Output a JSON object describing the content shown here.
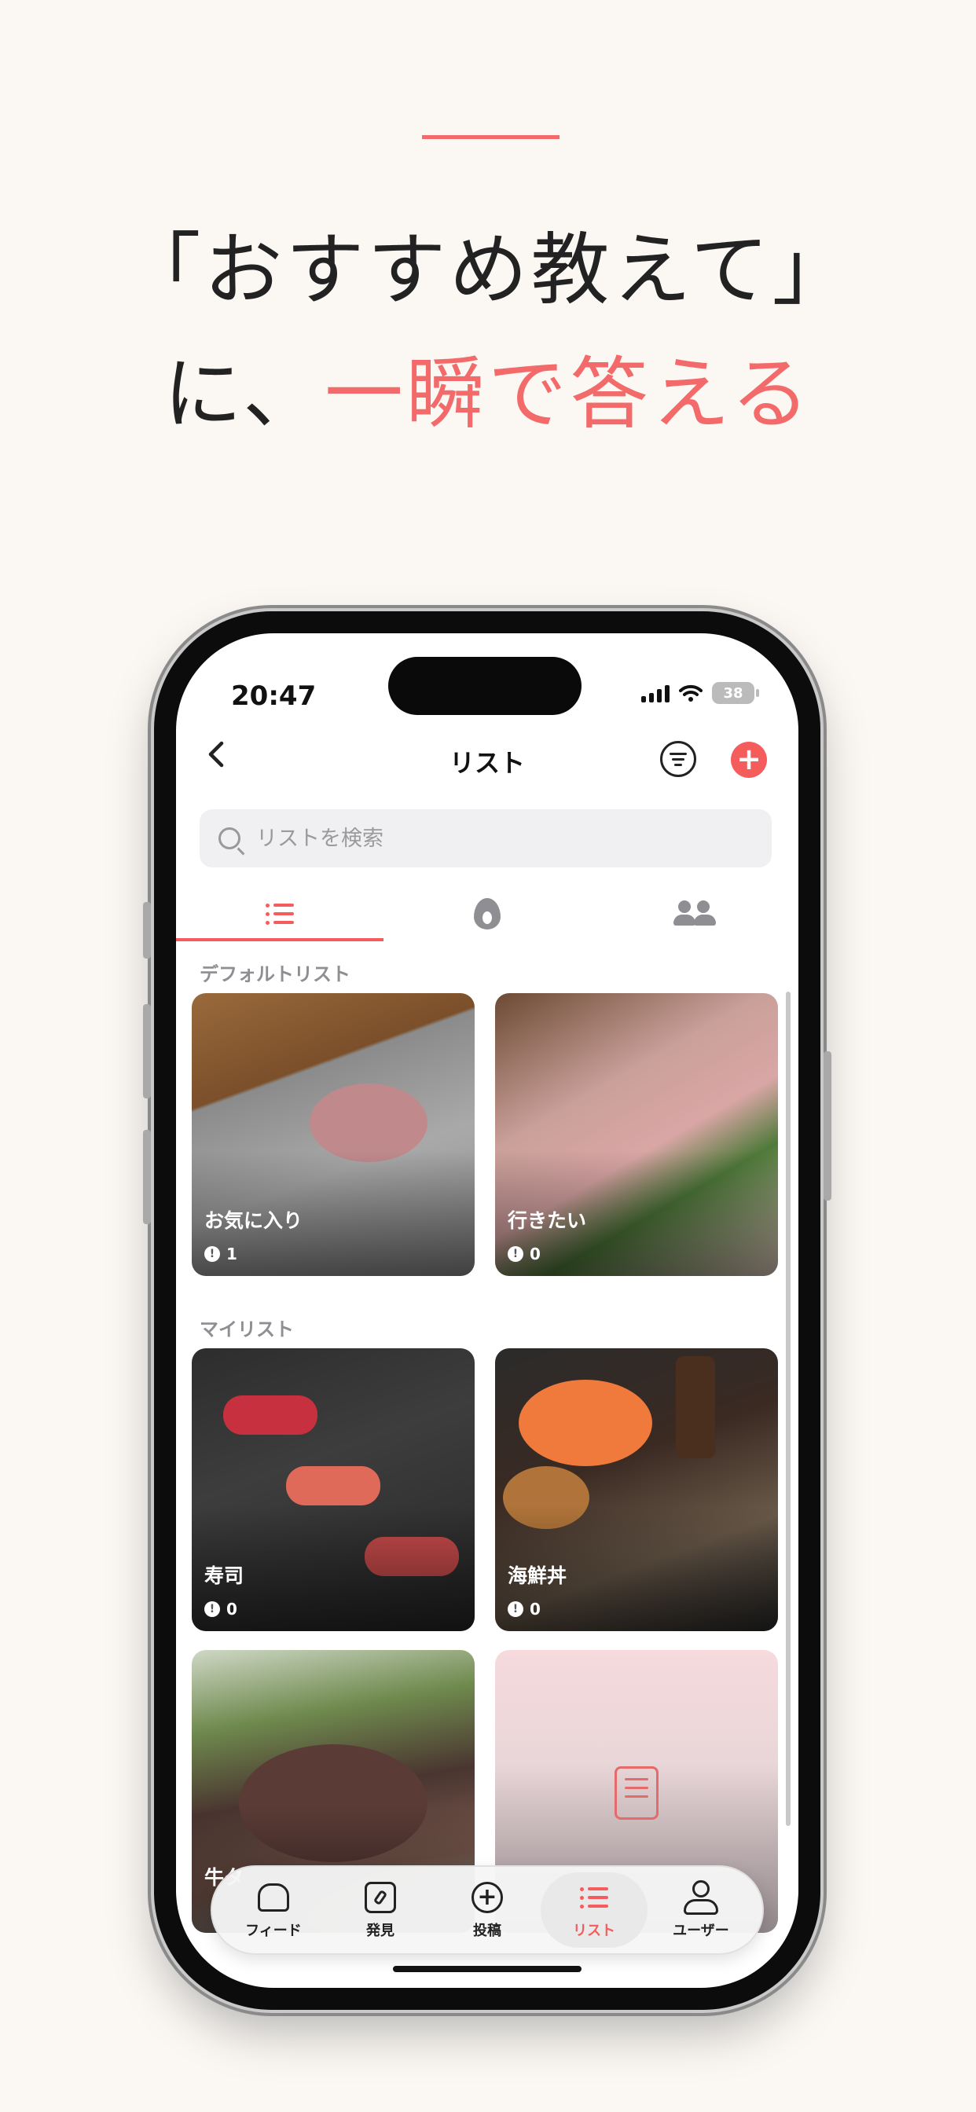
{
  "headline": {
    "line1": "「おすすめ教えて」",
    "line2_prefix": "に、",
    "line2_accent": "一瞬で答える"
  },
  "colors": {
    "accent": "#f36a6a",
    "background": "#fbf8f4"
  },
  "status_bar": {
    "time": "20:47",
    "battery": "38"
  },
  "nav": {
    "title": "リスト",
    "back_icon": "chevron-left-icon",
    "filter_icon": "filter-icon",
    "add_icon": "plus-icon"
  },
  "search": {
    "placeholder": "リストを検索",
    "value": ""
  },
  "tabs": [
    {
      "icon": "list-icon",
      "active": true
    },
    {
      "icon": "flame-icon",
      "active": false
    },
    {
      "icon": "people-icon",
      "active": false
    }
  ],
  "sections": {
    "default_label": "デフォルトリスト",
    "my_label": "マイリスト"
  },
  "default_lists": [
    {
      "name": "お気に入り",
      "count": "1"
    },
    {
      "name": "行きたい",
      "count": "0"
    }
  ],
  "my_lists": [
    {
      "name": "寿司",
      "count": "0"
    },
    {
      "name": "海鮮丼",
      "count": "0"
    },
    {
      "name": "牛タ",
      "count": ""
    }
  ],
  "tabbar": [
    {
      "label": "フィード",
      "icon": "home-icon",
      "active": false
    },
    {
      "label": "発見",
      "icon": "compass-icon",
      "active": false
    },
    {
      "label": "投稿",
      "icon": "plus-circle-icon",
      "active": false
    },
    {
      "label": "リスト",
      "icon": "list-icon",
      "active": true
    },
    {
      "label": "ユーザー",
      "icon": "user-icon",
      "active": false
    }
  ]
}
